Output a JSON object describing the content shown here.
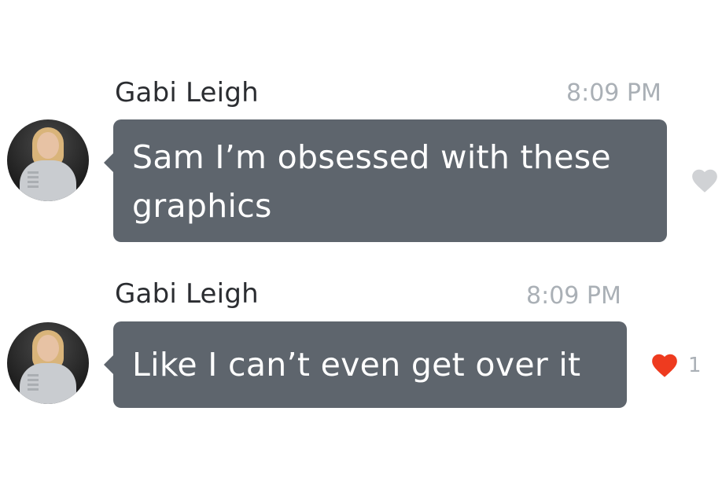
{
  "messages": [
    {
      "sender": "Gabi Leigh",
      "time": "8:09 PM",
      "text": "Sam I’m obsessed with these graphics",
      "liked": false,
      "like_count": ""
    },
    {
      "sender": "Gabi Leigh",
      "time": "8:09 PM",
      "text": "Like I can’t even get over it",
      "liked": true,
      "like_count": "1"
    }
  ],
  "colors": {
    "bubble": "#5e656d",
    "heart_active": "#ee3b1f",
    "heart_inactive": "#d0d2d5",
    "timestamp": "#aab0b6"
  },
  "icons": {
    "avatar": "user-avatar-photo",
    "like_inactive": "heart-outline-icon",
    "like_active": "heart-filled-icon"
  }
}
